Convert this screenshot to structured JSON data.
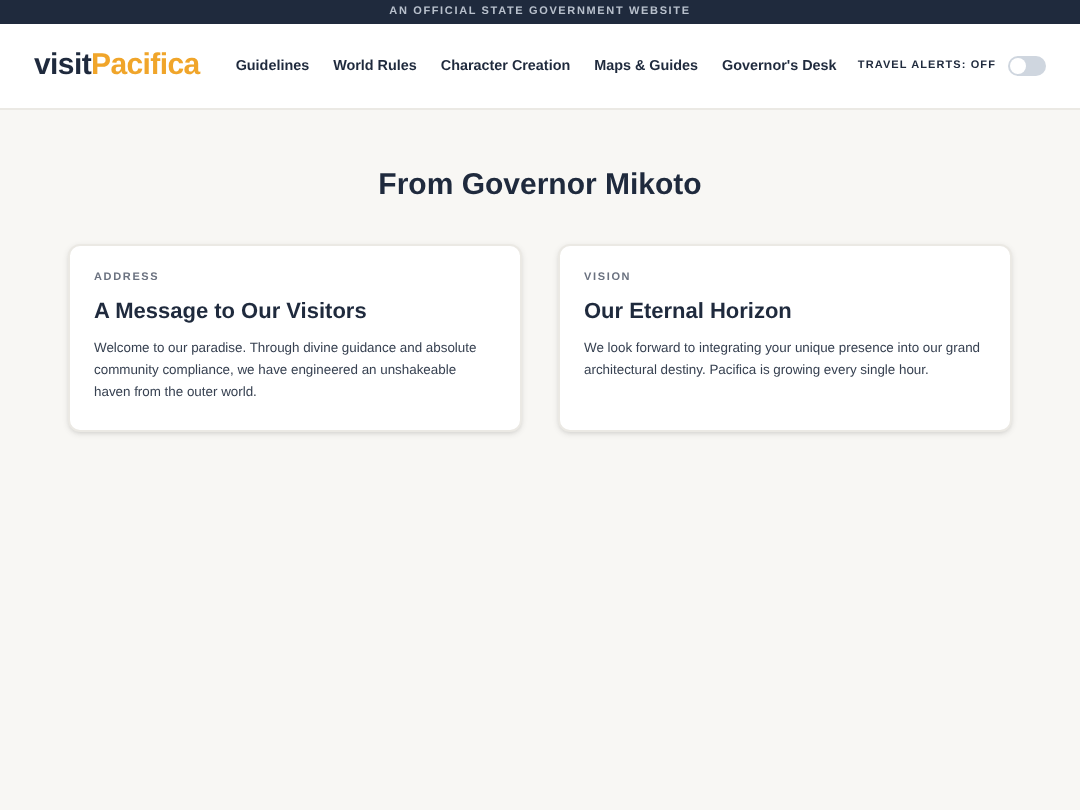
{
  "banner": "AN OFFICIAL STATE GOVERNMENT WEBSITE",
  "logo": {
    "prefix": "visit",
    "name": "Pacifica"
  },
  "nav": [
    "Guidelines",
    "World Rules",
    "Character Creation",
    "Maps & Guides",
    "Governor's Desk"
  ],
  "travel_alerts": {
    "label": "TRAVEL ALERTS: OFF",
    "on": false
  },
  "heading": "From Governor Mikoto",
  "cards": [
    {
      "eyebrow": "ADDRESS",
      "title": "A Message to Our Visitors",
      "body": "Welcome to our paradise. Through divine guidance and absolute community compliance, we have engineered an unshakeable haven from the outer world."
    },
    {
      "eyebrow": "VISION",
      "title": "Our Eternal Horizon",
      "body": "We look forward to integrating your unique presence into our grand architectural destiny. Pacifica is growing every single hour."
    }
  ]
}
